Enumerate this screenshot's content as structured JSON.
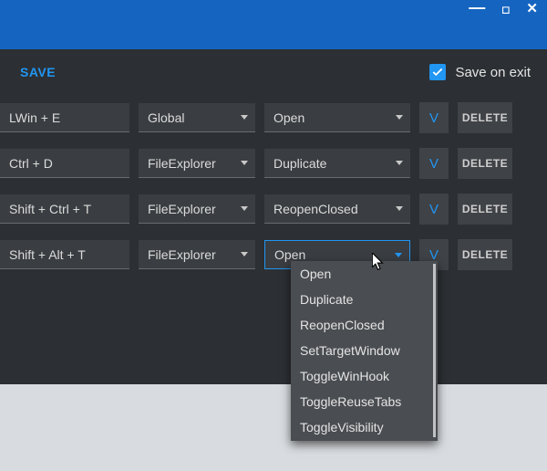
{
  "window": {
    "minimize_glyph": "—",
    "maximize_glyph": "◻",
    "close_glyph": "✕"
  },
  "topbar": {
    "save_label": "SAVE",
    "save_on_exit_label": "Save on exit",
    "save_on_exit_checked": true
  },
  "buttons": {
    "test_label": "V",
    "delete_label": "DELETE"
  },
  "rows": [
    {
      "hotkey": "LWin + E",
      "scope": "Global",
      "action": "Open"
    },
    {
      "hotkey": "Ctrl + D",
      "scope": "FileExplorer",
      "action": "Duplicate"
    },
    {
      "hotkey": "Shift + Ctrl + T",
      "scope": "FileExplorer",
      "action": "ReopenClosed"
    },
    {
      "hotkey": "Shift + Alt + T",
      "scope": "FileExplorer",
      "action": "Open"
    }
  ],
  "dropdown_options": [
    "Open",
    "Duplicate",
    "ReopenClosed",
    "SetTargetWindow",
    "ToggleWinHook",
    "ToggleReuseTabs",
    "ToggleVisibility"
  ]
}
